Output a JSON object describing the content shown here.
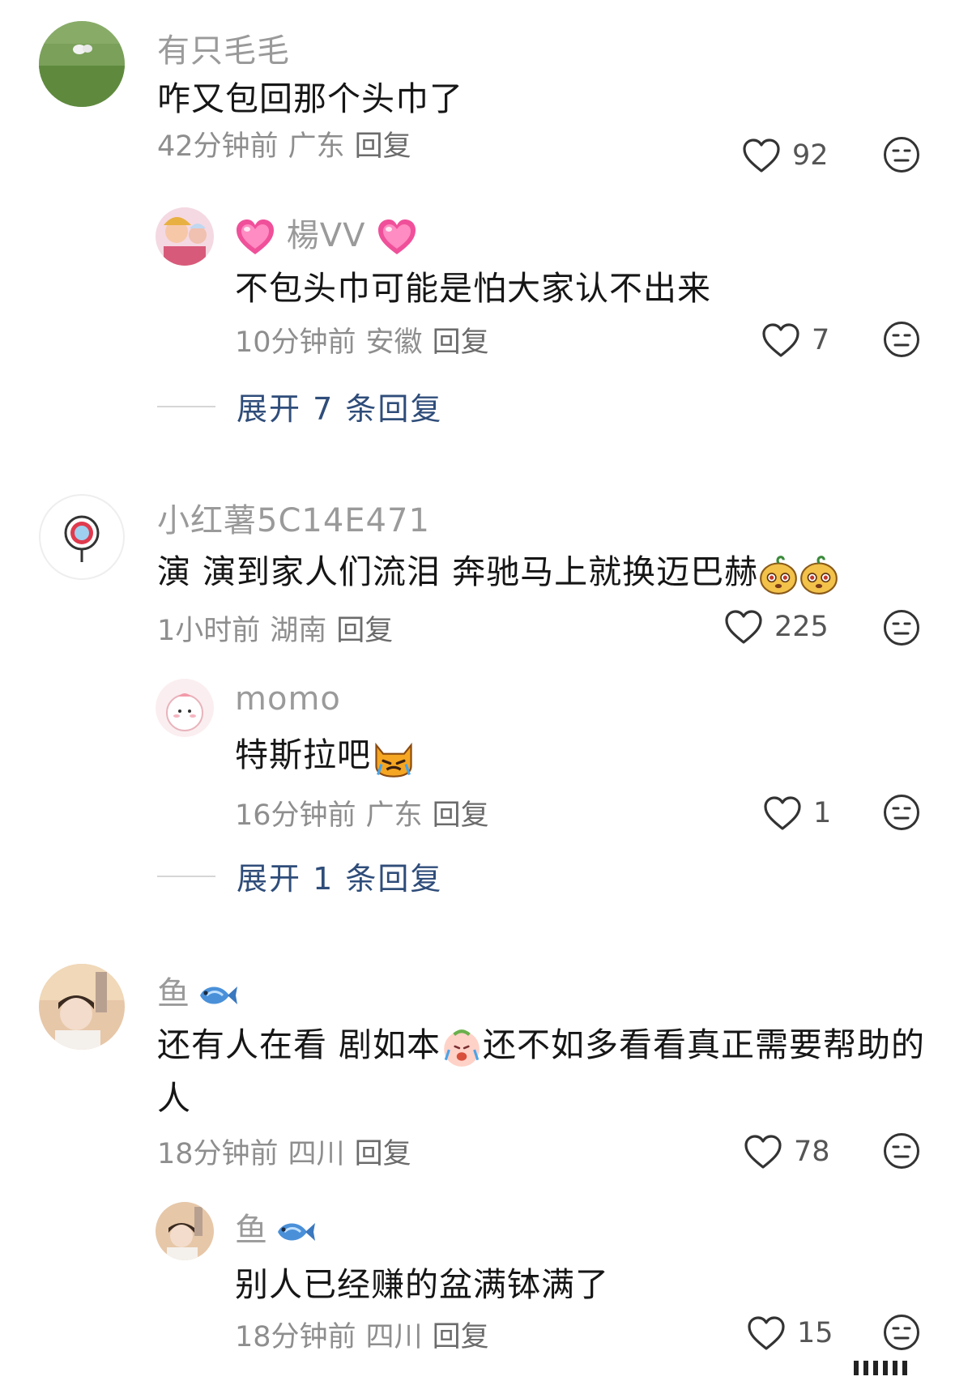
{
  "comments": [
    {
      "username": "有只毛毛",
      "text": "咋又包回那个头巾了",
      "time": "42分钟前",
      "region": "广东",
      "reply_label": "回复",
      "likes": "92",
      "replies": [
        {
          "username": "楊VV",
          "text": "不包头巾可能是怕大家认不出来",
          "time": "10分钟前",
          "region": "安徽",
          "reply_label": "回复",
          "likes": "7"
        }
      ],
      "expand_label": "展开 7 条回复"
    },
    {
      "username": "小红薯5C14E471",
      "text": "演 演到家人们流泪 奔驰马上就换迈巴赫",
      "time": "1小时前",
      "region": "湖南",
      "reply_label": "回复",
      "likes": "225",
      "replies": [
        {
          "username": "momo",
          "text": "特斯拉吧",
          "time": "16分钟前",
          "region": "广东",
          "reply_label": "回复",
          "likes": "1"
        }
      ],
      "expand_label": "展开 1 条回复"
    },
    {
      "username": "鱼",
      "text_line1_a": "还有人在看 剧如本",
      "text_line1_b": "还不如多看看真正需要帮助的",
      "text_line2": "人",
      "time": "18分钟前",
      "region": "四川",
      "reply_label": "回复",
      "likes": "78",
      "replies": [
        {
          "username": "鱼",
          "text": "别人已经赚的盆满钵满了",
          "time": "18分钟前",
          "region": "四川",
          "reply_label": "回复",
          "likes": "15"
        }
      ]
    }
  ],
  "icons": {
    "like": "heart-outline-icon",
    "dislike": "neutral-face-icon"
  },
  "colors": {
    "expand_link": "#2f4d7a",
    "username": "#9a9a9a",
    "meta": "#8e8e8e"
  }
}
